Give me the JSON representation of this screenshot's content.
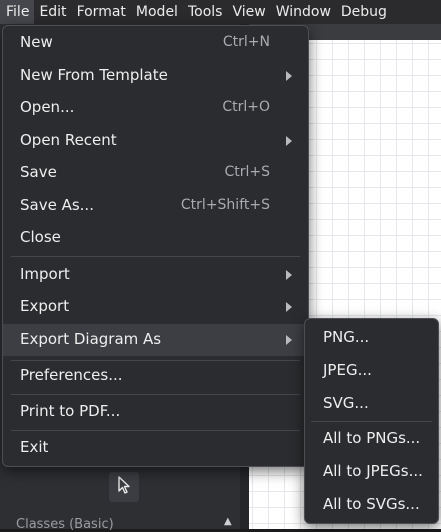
{
  "menubar": {
    "items": [
      "File",
      "Edit",
      "Format",
      "Model",
      "Tools",
      "View",
      "Window",
      "Debug"
    ],
    "active": "File"
  },
  "file_menu": {
    "new": {
      "label": "New",
      "shortcut": "Ctrl+N"
    },
    "new_from_template": {
      "label": "New From Template"
    },
    "open": {
      "label": "Open...",
      "shortcut": "Ctrl+O"
    },
    "open_recent": {
      "label": "Open Recent"
    },
    "save": {
      "label": "Save",
      "shortcut": "Ctrl+S"
    },
    "save_as": {
      "label": "Save As...",
      "shortcut": "Ctrl+Shift+S"
    },
    "close": {
      "label": "Close"
    },
    "import": {
      "label": "Import"
    },
    "export": {
      "label": "Export"
    },
    "export_diagram_as": {
      "label": "Export Diagram As"
    },
    "preferences": {
      "label": "Preferences..."
    },
    "print_to_pdf": {
      "label": "Print to PDF..."
    },
    "exit": {
      "label": "Exit"
    }
  },
  "export_submenu": {
    "png": "PNG...",
    "jpeg": "JPEG...",
    "svg": "SVG...",
    "all_pngs": "All to PNGs...",
    "all_jpegs": "All to JPEGs...",
    "all_svgs": "All to SVGs..."
  },
  "sidebar": {
    "section_label": "Classes (Basic)",
    "tool_icon": "pointer-arrow-icon"
  },
  "colors": {
    "menu_bg": "#2b2c2f",
    "menu_highlight": "#3c3e43",
    "menubar_bg": "#2b2b2d",
    "canvas_bg": "#ffffff",
    "grid": "#e6e7ea"
  }
}
